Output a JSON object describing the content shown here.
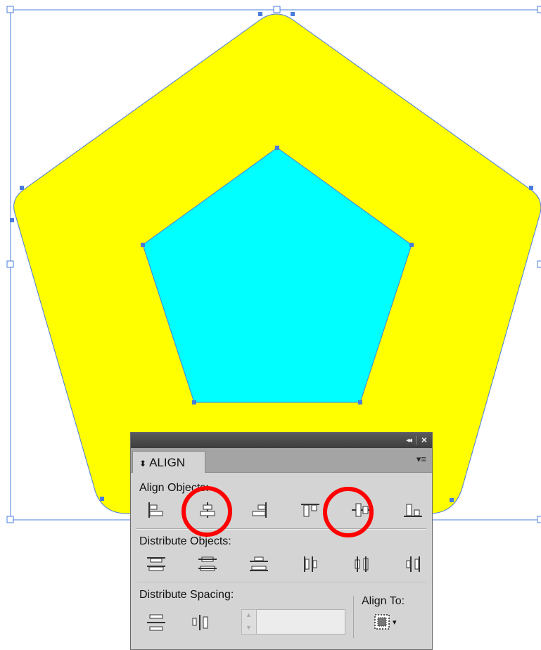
{
  "colors": {
    "outer_shape": "#ffff00",
    "inner_shape": "#00ffff",
    "selection": "#4a7cdc",
    "highlight": "#ff0000",
    "panel_bg": "#d4d4d4",
    "panel_titlebar": "#4a4a4a"
  },
  "panel": {
    "collapse_glyph": "◂◂",
    "close_glyph": "×",
    "tab_arrows": "⬍",
    "tab_label": "ALIGN",
    "menu_glyph": "▾≡",
    "sections": {
      "align_objects": {
        "label": "Align Objects:",
        "buttons": [
          "horizontal-align-left-icon",
          "horizontal-align-center-icon",
          "horizontal-align-right-icon",
          "vertical-align-top-icon",
          "vertical-align-center-icon",
          "vertical-align-bottom-icon"
        ],
        "highlighted": [
          "horizontal-align-center-icon",
          "vertical-align-center-icon"
        ]
      },
      "distribute_objects": {
        "label": "Distribute Objects:",
        "buttons": [
          "vertical-distribute-top-icon",
          "vertical-distribute-center-icon",
          "vertical-distribute-bottom-icon",
          "horizontal-distribute-left-icon",
          "horizontal-distribute-center-icon",
          "horizontal-distribute-right-icon"
        ]
      },
      "distribute_spacing": {
        "label": "Distribute Spacing:",
        "buttons": [
          "vertical-distribute-space-icon",
          "horizontal-distribute-space-icon"
        ],
        "input_value": ""
      },
      "align_to": {
        "label": "Align To:",
        "icon": "align-to-selection-icon",
        "dropdown_glyph": "▾"
      }
    }
  }
}
